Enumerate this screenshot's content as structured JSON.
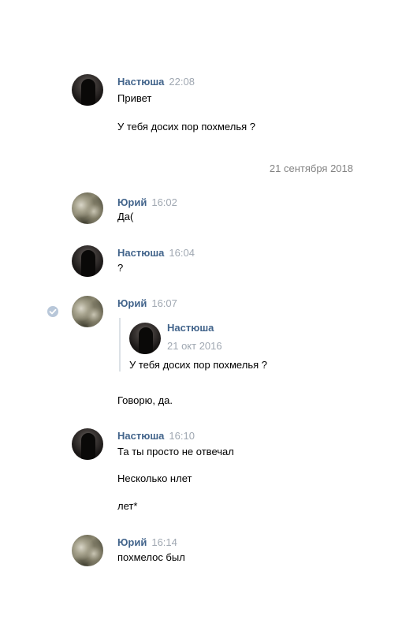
{
  "colors": {
    "author": "#42648b",
    "time": "#a0a8b2",
    "date_separator": "#828282",
    "text": "#000000"
  },
  "date_separator": "21 сентября 2018",
  "messages": [
    {
      "author": "Настюша",
      "time": "22:08",
      "avatar": "girl-dark-photo",
      "lines": [
        "Привет",
        "У тебя досих пор похмелья ?"
      ]
    },
    {
      "author": "Юрий",
      "time": "16:02",
      "avatar": "guy-light-photo",
      "lines": [
        "Да("
      ]
    },
    {
      "author": "Настюша",
      "time": "16:04",
      "avatar": "girl-dark-photo",
      "lines": [
        "?"
      ]
    },
    {
      "author": "Юрий",
      "time": "16:07",
      "avatar": "guy-light-photo",
      "status_icon": "check-icon",
      "quote": {
        "author": "Настюша",
        "date": "21 окт 2016",
        "text": "У тебя досих пор похмелья ?"
      },
      "lines": [
        "Говорю, да."
      ]
    },
    {
      "author": "Настюша",
      "time": "16:10",
      "avatar": "girl-dark-photo",
      "lines": [
        "Та ты просто не отвечал",
        "Несколько нлет",
        "лет*"
      ]
    },
    {
      "author": "Юрий",
      "time": "16:14",
      "avatar": "guy-light-photo",
      "lines": [
        "похмелос был"
      ]
    }
  ]
}
